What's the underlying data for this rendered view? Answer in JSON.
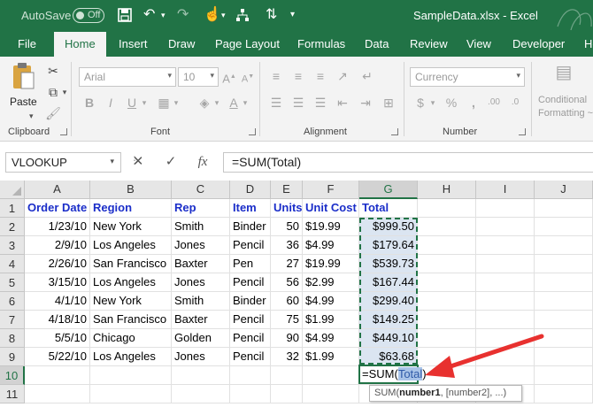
{
  "titlebar": {
    "autosave_label": "AutoSave",
    "autosave_state": "Off",
    "document_title": "SampleData.xlsx  -  Excel",
    "brand_color": "#217346"
  },
  "tabs": [
    {
      "label": "File"
    },
    {
      "label": "Home"
    },
    {
      "label": "Insert"
    },
    {
      "label": "Draw"
    },
    {
      "label": "Page Layout"
    },
    {
      "label": "Formulas"
    },
    {
      "label": "Data"
    },
    {
      "label": "Review"
    },
    {
      "label": "View"
    },
    {
      "label": "Developer"
    },
    {
      "label": "He"
    }
  ],
  "ribbon": {
    "paste_label": "Paste",
    "font_name": "Arial",
    "font_size": "10",
    "number_format": "Currency",
    "conditional_formatting_label": [
      "Conditional",
      "Formatting ~"
    ],
    "groups": {
      "clipboard": "Clipboard",
      "font": "Font",
      "alignment": "Alignment",
      "number": "Number"
    }
  },
  "formula_bar": {
    "name_box": "VLOOKUP",
    "fx": "fx",
    "formula": "=SUM(Total)"
  },
  "columns": [
    "A",
    "B",
    "C",
    "D",
    "E",
    "F",
    "G",
    "H",
    "I",
    "J"
  ],
  "rows": [
    "1",
    "2",
    "3",
    "4",
    "5",
    "6",
    "7",
    "8",
    "9",
    "10",
    "11"
  ],
  "sheet": {
    "headers": [
      "Order Date",
      "Region",
      "Rep",
      "Item",
      "Units",
      "Unit Cost",
      "Total"
    ],
    "data": [
      [
        "1/23/10",
        "New York",
        "Smith",
        "Binder",
        "50",
        "$19.99",
        "$999.50"
      ],
      [
        "2/9/10",
        "Los Angeles",
        "Jones",
        "Pencil",
        "36",
        "$4.99",
        "$179.64"
      ],
      [
        "2/26/10",
        "San Francisco",
        "Baxter",
        "Pen",
        "27",
        "$19.99",
        "$539.73"
      ],
      [
        "3/15/10",
        "Los Angeles",
        "Jones",
        "Pencil",
        "56",
        "$2.99",
        "$167.44"
      ],
      [
        "4/1/10",
        "New York",
        "Smith",
        "Binder",
        "60",
        "$4.99",
        "$299.40"
      ],
      [
        "4/18/10",
        "San Francisco",
        "Baxter",
        "Pencil",
        "75",
        "$1.99",
        "$149.25"
      ],
      [
        "5/5/10",
        "Chicago",
        "Golden",
        "Pencil",
        "90",
        "$4.99",
        "$449.10"
      ],
      [
        "5/22/10",
        "Los Angeles",
        "Jones",
        "Pencil",
        "32",
        "$1.99",
        "$63.68"
      ]
    ]
  },
  "active_cell": {
    "prefix": "=SUM(",
    "reference": "Total",
    "suffix": ")"
  },
  "tooltip": {
    "func": "SUM(",
    "arg1": "number1",
    "rest": ", [number2], ...)"
  },
  "colors": {
    "header_text": "#1b2ec9",
    "selection_highlight": "#dbe5f1",
    "arrow": "#e8312f"
  }
}
